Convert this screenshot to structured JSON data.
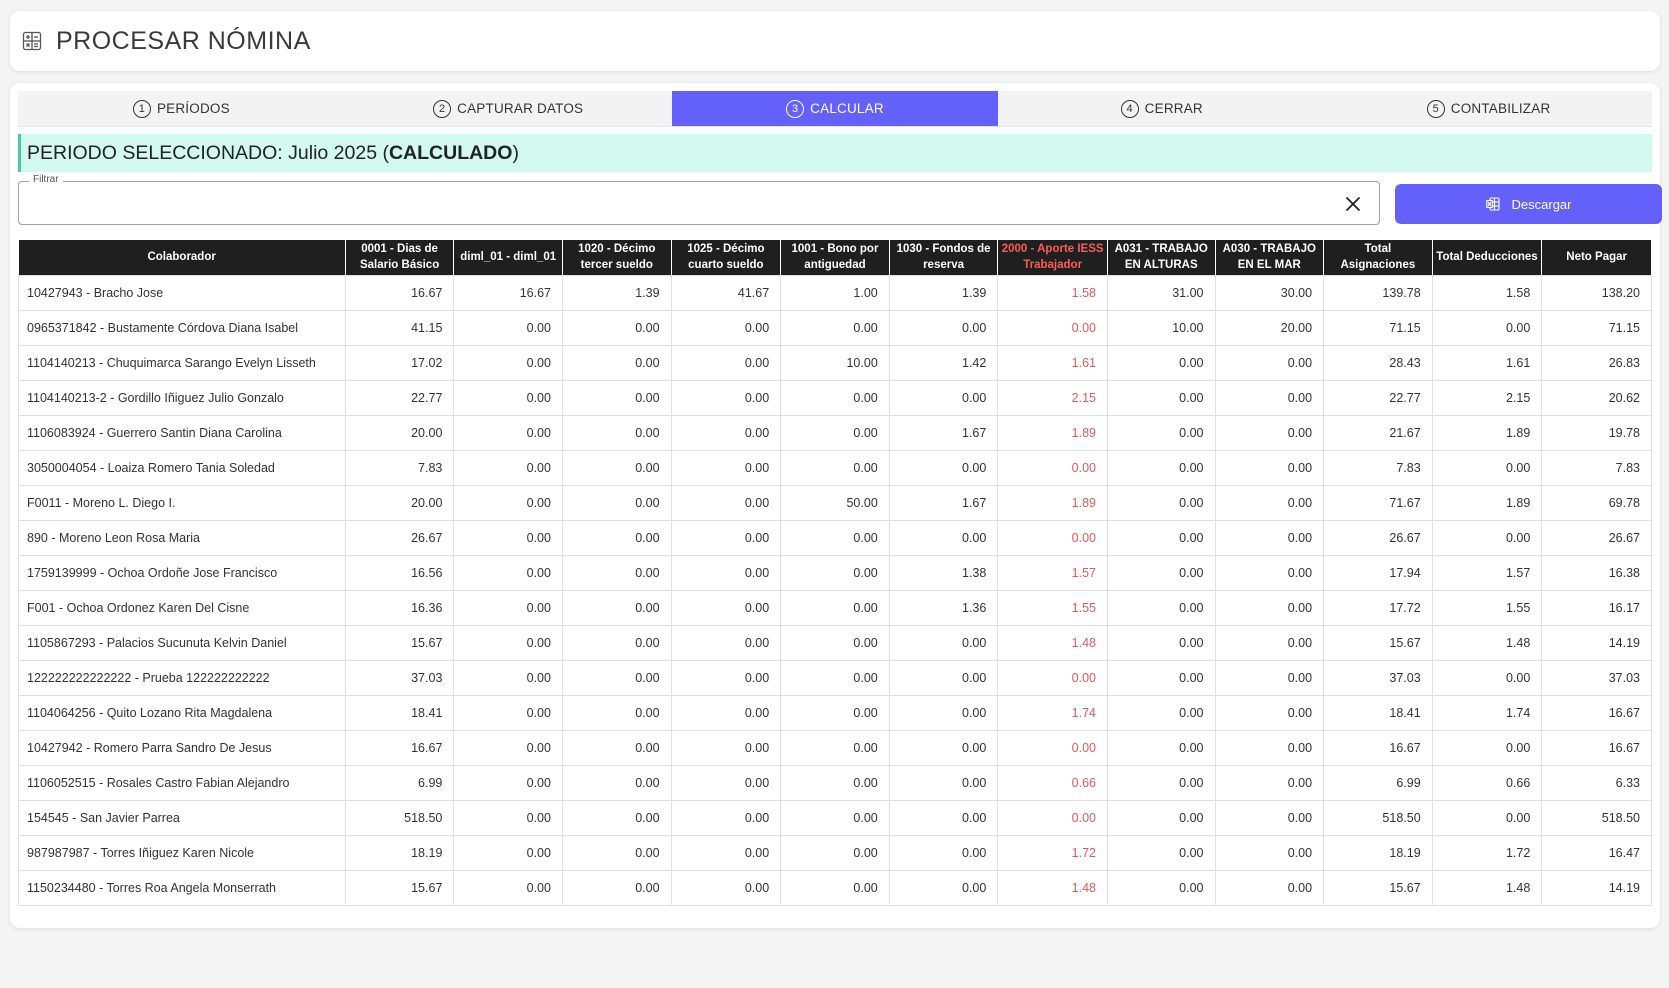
{
  "header": {
    "title": "PROCESAR NÓMINA"
  },
  "tabs": [
    {
      "num": "1",
      "label": "PERÍODOS"
    },
    {
      "num": "2",
      "label": "CAPTURAR DATOS"
    },
    {
      "num": "3",
      "label": "CALCULAR"
    },
    {
      "num": "4",
      "label": "CERRAR"
    },
    {
      "num": "5",
      "label": "CONTABILIZAR"
    }
  ],
  "active_tab": "CALCULAR",
  "period": {
    "prefix": "PERIODO SELECCIONADO: Julio 2025 (",
    "status": "CALCULADO",
    "suffix": ")"
  },
  "filter": {
    "label": "Filtrar",
    "value": ""
  },
  "download_label": "Descargar",
  "colors": {
    "accent": "#6461fb",
    "banner": "#d2f8ef",
    "highlight_red": "#e05a5a"
  },
  "table": {
    "headers": [
      "Colaborador",
      "0001 - Dias de Salario Básico",
      "diml_01 - diml_01",
      "1020 - Décimo tercer sueldo",
      "1025 - Décimo cuarto sueldo",
      "1001 - Bono por antiguedad",
      "1030 - Fondos de reserva",
      "2000 - Aporte IESS Trabajador",
      "A031 - TRABAJO EN ALTURAS",
      "A030 - TRABAJO EN EL MAR",
      "Total Asignaciones",
      "Total Deducciones",
      "Neto Pagar"
    ],
    "rows": [
      [
        "10427943 - Bracho Jose",
        "16.67",
        "16.67",
        "1.39",
        "41.67",
        "1.00",
        "1.39",
        "1.58",
        "31.00",
        "30.00",
        "139.78",
        "1.58",
        "138.20"
      ],
      [
        "0965371842 - Bustamente Córdova Diana Isabel",
        "41.15",
        "0.00",
        "0.00",
        "0.00",
        "0.00",
        "0.00",
        "0.00",
        "10.00",
        "20.00",
        "71.15",
        "0.00",
        "71.15"
      ],
      [
        "1104140213 - Chuquimarca Sarango Evelyn Lisseth",
        "17.02",
        "0.00",
        "0.00",
        "0.00",
        "10.00",
        "1.42",
        "1.61",
        "0.00",
        "0.00",
        "28.43",
        "1.61",
        "26.83"
      ],
      [
        "1104140213-2 - Gordillo Iñiguez Julio Gonzalo",
        "22.77",
        "0.00",
        "0.00",
        "0.00",
        "0.00",
        "0.00",
        "2.15",
        "0.00",
        "0.00",
        "22.77",
        "2.15",
        "20.62"
      ],
      [
        "1106083924 - Guerrero Santin Diana Carolina",
        "20.00",
        "0.00",
        "0.00",
        "0.00",
        "0.00",
        "1.67",
        "1.89",
        "0.00",
        "0.00",
        "21.67",
        "1.89",
        "19.78"
      ],
      [
        "3050004054 - Loaiza Romero Tania Soledad",
        "7.83",
        "0.00",
        "0.00",
        "0.00",
        "0.00",
        "0.00",
        "0.00",
        "0.00",
        "0.00",
        "7.83",
        "0.00",
        "7.83"
      ],
      [
        "F0011 - Moreno L. Diego I.",
        "20.00",
        "0.00",
        "0.00",
        "0.00",
        "50.00",
        "1.67",
        "1.89",
        "0.00",
        "0.00",
        "71.67",
        "1.89",
        "69.78"
      ],
      [
        "890 - Moreno Leon Rosa Maria",
        "26.67",
        "0.00",
        "0.00",
        "0.00",
        "0.00",
        "0.00",
        "0.00",
        "0.00",
        "0.00",
        "26.67",
        "0.00",
        "26.67"
      ],
      [
        "1759139999 - Ochoa Ordoñe Jose Francisco",
        "16.56",
        "0.00",
        "0.00",
        "0.00",
        "0.00",
        "1.38",
        "1.57",
        "0.00",
        "0.00",
        "17.94",
        "1.57",
        "16.38"
      ],
      [
        "F001 - Ochoa Ordonez Karen Del Cisne",
        "16.36",
        "0.00",
        "0.00",
        "0.00",
        "0.00",
        "1.36",
        "1.55",
        "0.00",
        "0.00",
        "17.72",
        "1.55",
        "16.17"
      ],
      [
        "1105867293 - Palacios Sucunuta Kelvin Daniel",
        "15.67",
        "0.00",
        "0.00",
        "0.00",
        "0.00",
        "0.00",
        "1.48",
        "0.00",
        "0.00",
        "15.67",
        "1.48",
        "14.19"
      ],
      [
        "122222222222222 - Prueba 122222222222",
        "37.03",
        "0.00",
        "0.00",
        "0.00",
        "0.00",
        "0.00",
        "0.00",
        "0.00",
        "0.00",
        "37.03",
        "0.00",
        "37.03"
      ],
      [
        "1104064256 - Quito Lozano Rita Magdalena",
        "18.41",
        "0.00",
        "0.00",
        "0.00",
        "0.00",
        "0.00",
        "1.74",
        "0.00",
        "0.00",
        "18.41",
        "1.74",
        "16.67"
      ],
      [
        "10427942 - Romero Parra Sandro De Jesus",
        "16.67",
        "0.00",
        "0.00",
        "0.00",
        "0.00",
        "0.00",
        "0.00",
        "0.00",
        "0.00",
        "16.67",
        "0.00",
        "16.67"
      ],
      [
        "1106052515 - Rosales Castro Fabian Alejandro",
        "6.99",
        "0.00",
        "0.00",
        "0.00",
        "0.00",
        "0.00",
        "0.66",
        "0.00",
        "0.00",
        "6.99",
        "0.66",
        "6.33"
      ],
      [
        "154545 - San Javier Parrea",
        "518.50",
        "0.00",
        "0.00",
        "0.00",
        "0.00",
        "0.00",
        "0.00",
        "0.00",
        "0.00",
        "518.50",
        "0.00",
        "518.50"
      ],
      [
        "987987987 - Torres Iñiguez Karen Nicole",
        "18.19",
        "0.00",
        "0.00",
        "0.00",
        "0.00",
        "0.00",
        "1.72",
        "0.00",
        "0.00",
        "18.19",
        "1.72",
        "16.47"
      ],
      [
        "1150234480 - Torres Roa Angela Monserrath",
        "15.67",
        "0.00",
        "0.00",
        "0.00",
        "0.00",
        "0.00",
        "1.48",
        "0.00",
        "0.00",
        "15.67",
        "1.48",
        "14.19"
      ]
    ]
  }
}
